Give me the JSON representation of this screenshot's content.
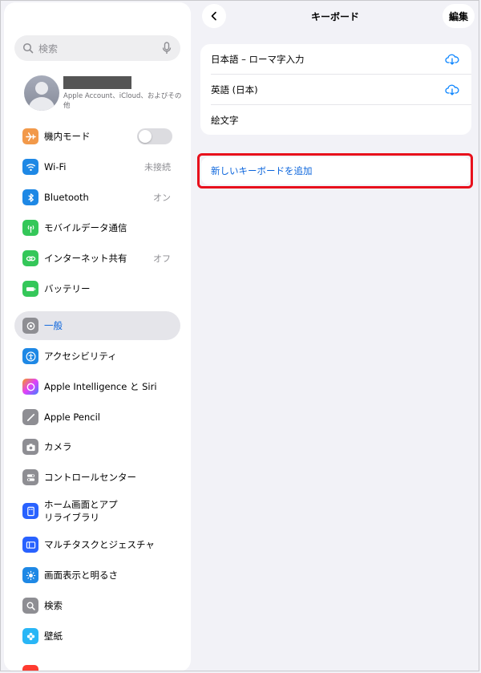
{
  "sidebar": {
    "search_placeholder": "検索",
    "profile_sub": "Apple Account、iCloud、およびその他",
    "items": [
      {
        "label": "機内モード",
        "value": "",
        "color": "#f2994a",
        "icon": "airplane-icon"
      },
      {
        "label": "Wi-Fi",
        "value": "未接続",
        "color": "#1e88e5",
        "icon": "wifi-icon"
      },
      {
        "label": "Bluetooth",
        "value": "オン",
        "color": "#1e88e5",
        "icon": "bluetooth-icon"
      },
      {
        "label": "モバイルデータ通信",
        "value": "",
        "color": "#34c759",
        "icon": "antenna-icon"
      },
      {
        "label": "インターネット共有",
        "value": "オフ",
        "color": "#34c759",
        "icon": "link-icon"
      },
      {
        "label": "バッテリー",
        "value": "",
        "color": "#34c759",
        "icon": "battery-icon"
      },
      {
        "label": "一般",
        "value": "",
        "color": "#8e8e93",
        "icon": "gear-icon"
      },
      {
        "label": "アクセシビリティ",
        "value": "",
        "color": "#1e88e5",
        "icon": "accessibility-icon"
      },
      {
        "label": "Apple Intelligence と Siri",
        "value": "",
        "color": "#e040fb",
        "icon": "siri-icon"
      },
      {
        "label": "Apple Pencil",
        "value": "",
        "color": "#8e8e93",
        "icon": "pencil-icon"
      },
      {
        "label": "カメラ",
        "value": "",
        "color": "#8e8e93",
        "icon": "camera-icon"
      },
      {
        "label": "コントロールセンター",
        "value": "",
        "color": "#8e8e93",
        "icon": "switches-icon"
      },
      {
        "label": "ホーム画面とアプリライブラリ",
        "value": "",
        "color": "#2962ff",
        "icon": "home-screen-icon"
      },
      {
        "label": "マルチタスクとジェスチャ",
        "value": "",
        "color": "#2962ff",
        "icon": "multitask-icon"
      },
      {
        "label": "画面表示と明るさ",
        "value": "",
        "color": "#1e88e5",
        "icon": "sun-icon"
      },
      {
        "label": "検索",
        "value": "",
        "color": "#8e8e93",
        "icon": "search-icon"
      },
      {
        "label": "壁紙",
        "value": "",
        "color": "#29b6f6",
        "icon": "flower-icon"
      }
    ]
  },
  "nav": {
    "title": "キーボード",
    "edit_label": "編集"
  },
  "keyboards": [
    {
      "label": "日本語 – ローマ字入力",
      "icon": "cloud-download-icon"
    },
    {
      "label": "英語 (日本)",
      "icon": "cloud-download-icon"
    },
    {
      "label": "絵文字",
      "icon": ""
    }
  ],
  "add_keyboard_label": "新しいキーボードを追加",
  "colors": {
    "accent": "#0a64dc",
    "highlight": "#e8101c"
  }
}
